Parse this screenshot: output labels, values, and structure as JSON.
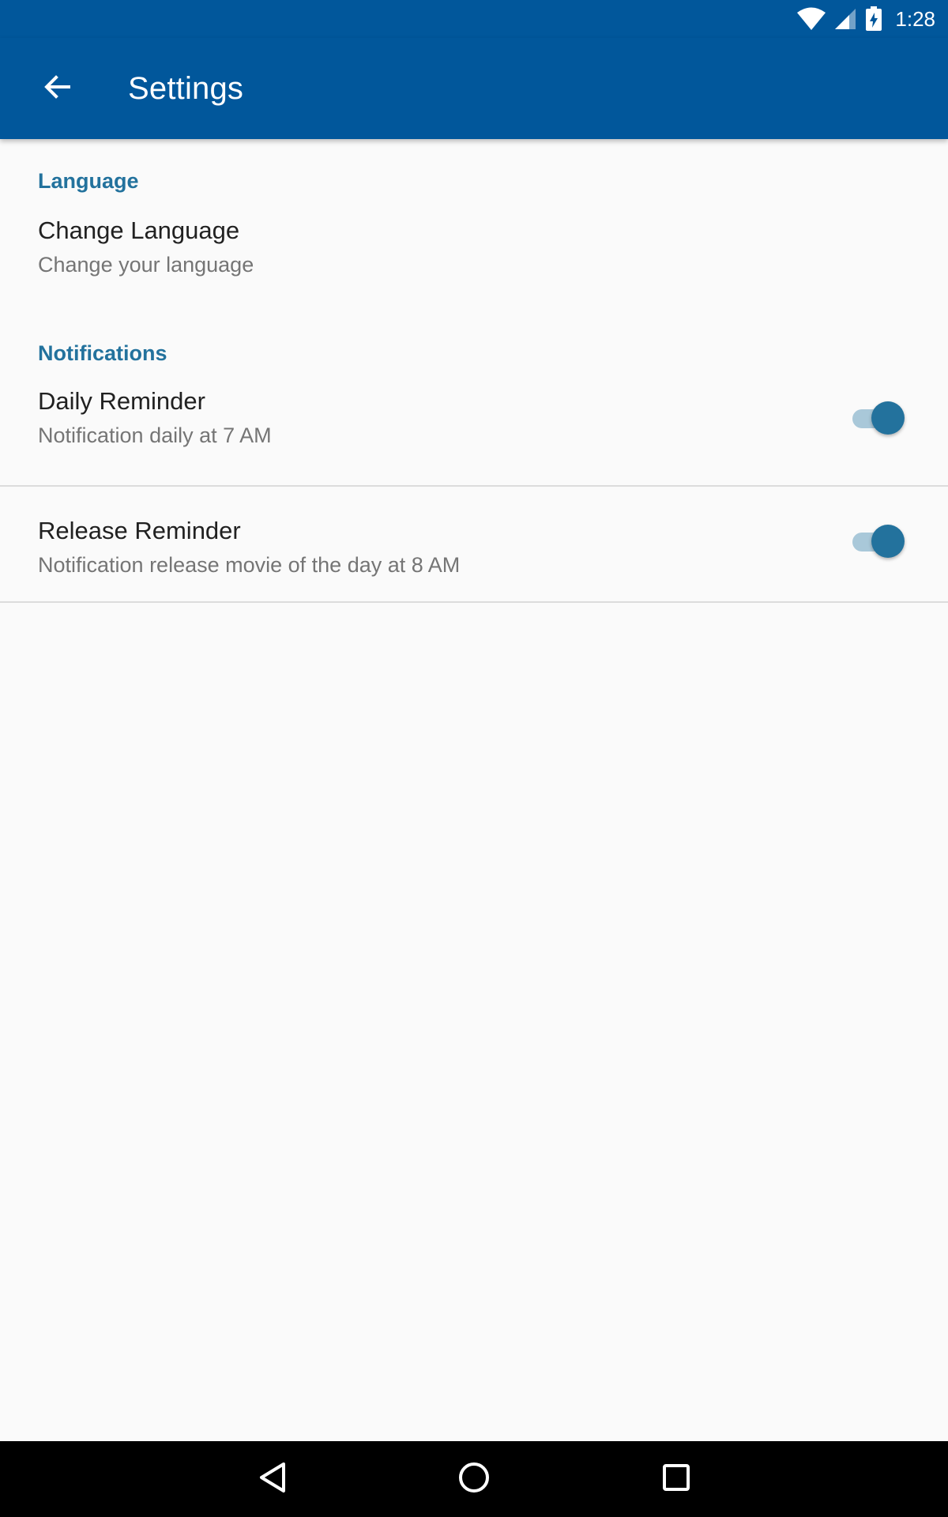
{
  "status_bar": {
    "time": "1:28",
    "icons": [
      "wifi-icon",
      "cell-signal-icon",
      "battery-charging-icon"
    ]
  },
  "app_bar": {
    "title": "Settings",
    "back_icon": "arrow-back-icon"
  },
  "sections": {
    "language": {
      "header": "Language",
      "items": [
        {
          "title": "Change Language",
          "summary": "Change your language"
        }
      ]
    },
    "notifications": {
      "header": "Notifications",
      "items": [
        {
          "title": "Daily Reminder",
          "summary": "Notification daily at 7 AM",
          "enabled": true
        },
        {
          "title": "Release Reminder",
          "summary": "Notification release movie of the day at 8 AM",
          "enabled": true
        }
      ]
    }
  },
  "nav_bar": {
    "icons": [
      "nav-back-icon",
      "nav-home-icon",
      "nav-recents-icon"
    ]
  },
  "colors": {
    "primary": "#01579b",
    "accent": "#23729d",
    "switch_track": "#a9c8d9",
    "background": "#fafafa"
  }
}
